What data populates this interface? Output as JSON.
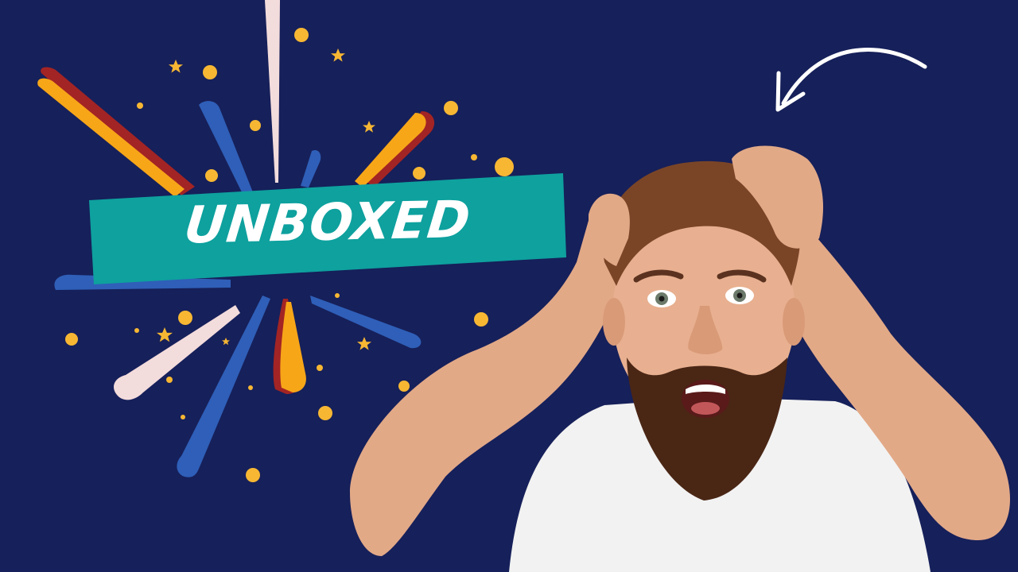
{
  "banner": {
    "text": "UNBOXED"
  },
  "colors": {
    "background": "#16205a",
    "banner": "#0ea19e",
    "banner_text": "#ffffff",
    "accent_orange": "#f7a618",
    "accent_red": "#a32424",
    "accent_blue": "#2f5fb8",
    "accent_pink": "#f3dcdc",
    "dot_yellow": "#f7b733",
    "arrow": "#ffffff",
    "shirt": "#f2f2f2",
    "skin": "#e2a987",
    "hair": "#7a4527",
    "beard": "#4a2615"
  },
  "icons": {
    "arrow": "curved-arrow-icon",
    "star": "star-icon",
    "dot": "confetti-dot"
  }
}
